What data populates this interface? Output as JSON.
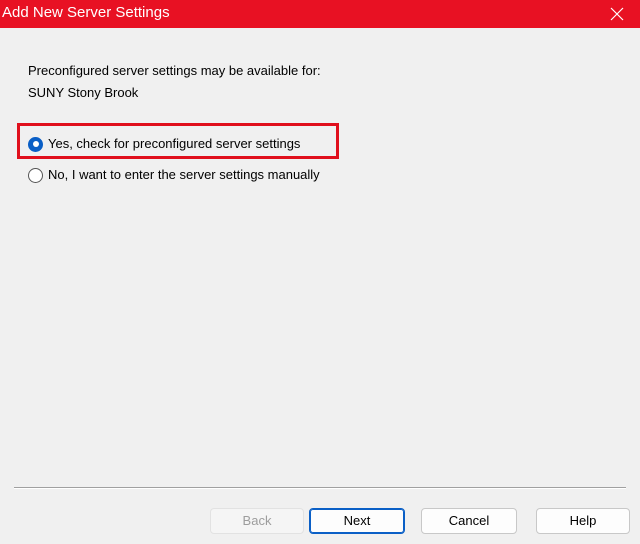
{
  "window": {
    "title": "Add New Server Settings",
    "close_icon": "close-icon",
    "titlebar_color": "#e81123"
  },
  "content": {
    "description": "Preconfigured server settings may be available for:",
    "organization": "SUNY Stony Brook",
    "highlight_color": "#e00f1c",
    "options": [
      {
        "label": "Yes, check for preconfigured server settings",
        "selected": true
      },
      {
        "label": "No, I want to enter the server settings manually",
        "selected": false
      }
    ],
    "accent_color": "#0a5fc6"
  },
  "buttons": {
    "back": {
      "label": "Back",
      "disabled": true
    },
    "next": {
      "label": "Next",
      "default": true
    },
    "cancel": {
      "label": "Cancel"
    },
    "help": {
      "label": "Help"
    }
  }
}
